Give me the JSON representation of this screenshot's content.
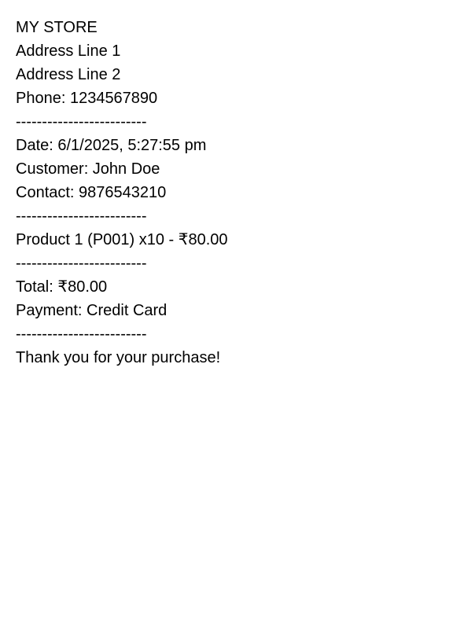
{
  "receipt": {
    "store_name": "MY STORE",
    "address_line_1": "Address Line 1",
    "address_line_2": "Address Line 2",
    "phone": "Phone: 1234567890",
    "divider_1": "-------------------------",
    "date": "Date: 6/1/2025, 5:27:55 pm",
    "customer": "Customer: John Doe",
    "contact": "Contact: 9876543210",
    "divider_2": "-------------------------",
    "items": [
      "Product 1 (P001) x10 - ₹80.00"
    ],
    "divider_3": "-------------------------",
    "total": "Total: ₹80.00",
    "payment": "Payment: Credit Card",
    "divider_4": "-------------------------",
    "thank_you": "Thank you for your purchase!"
  }
}
